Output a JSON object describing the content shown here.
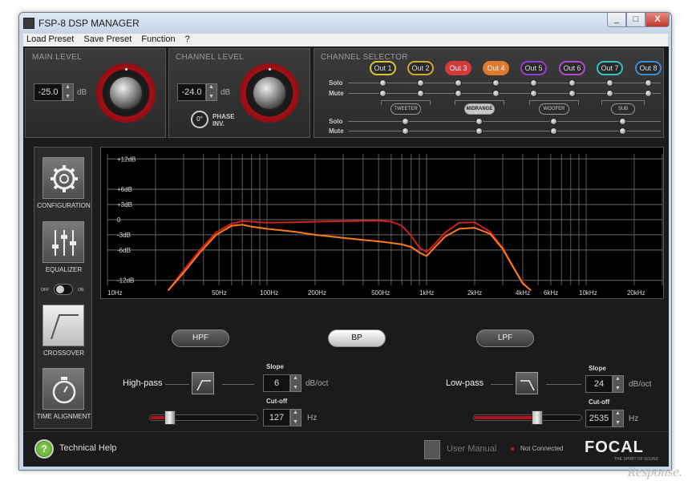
{
  "window": {
    "title": "FSP-8 DSP MANAGER",
    "minimize": "_",
    "maximize": "□",
    "close": "X"
  },
  "menu": [
    "Load Preset",
    "Save Preset",
    "Function",
    "?"
  ],
  "main_level": {
    "title": "MAIN LEVEL",
    "value": "-25.0",
    "unit": "dB"
  },
  "channel_level": {
    "title": "CHANNEL LEVEL",
    "value": "-24.0",
    "unit": "dB",
    "phase_value": "0°",
    "phase_label": "PHASE INV."
  },
  "channel_selector": {
    "title": "CHANNEL SELECTOR",
    "outputs": [
      {
        "label": "Out 1",
        "color": "#d8c531",
        "selected": false
      },
      {
        "label": "Out 2",
        "color": "#d8a531",
        "selected": false
      },
      {
        "label": "Out 3",
        "color": "#d23b3b",
        "selected": true
      },
      {
        "label": "Out 4",
        "color": "#e07a2e",
        "selected": true
      },
      {
        "label": "Out 5",
        "color": "#9b3ad1",
        "selected": false
      },
      {
        "label": "Out 6",
        "color": "#b14ad6",
        "selected": false
      },
      {
        "label": "Out 7",
        "color": "#31c3c3",
        "selected": false
      },
      {
        "label": "Out 8",
        "color": "#3a8fd8",
        "selected": false
      }
    ],
    "solo": "Solo",
    "mute": "Mute",
    "groups": [
      {
        "label": "TWEETER",
        "selected": false
      },
      {
        "label": "MIDRANGE",
        "selected": true
      },
      {
        "label": "WOOFER",
        "selected": false
      },
      {
        "label": "SUB",
        "selected": false
      }
    ]
  },
  "nav": [
    {
      "label": "CONFIGURATION",
      "icon": "gear-icon"
    },
    {
      "label": "EQUALIZER",
      "icon": "sliders-icon"
    },
    {
      "label": "CROSSOVER",
      "icon": "crossover-icon"
    },
    {
      "label": "TIME ALIGNMENT",
      "icon": "stopwatch-icon"
    }
  ],
  "eq_toggle": {
    "off": "OFF",
    "on": "ON"
  },
  "chart_data": {
    "type": "line",
    "x_scale": "log",
    "xlim": [
      10,
      30000
    ],
    "ylim": [
      -13,
      13
    ],
    "x_ticks": [
      {
        "value": 10,
        "label": "10Hz"
      },
      {
        "value": 50,
        "label": "50Hz"
      },
      {
        "value": 100,
        "label": "100Hz"
      },
      {
        "value": 200,
        "label": "200Hz"
      },
      {
        "value": 500,
        "label": "500Hz"
      },
      {
        "value": 1000,
        "label": "1kHz"
      },
      {
        "value": 2000,
        "label": "2kHz"
      },
      {
        "value": 4000,
        "label": "4kHz"
      },
      {
        "value": 6000,
        "label": "6kHz"
      },
      {
        "value": 10000,
        "label": "10kHz"
      },
      {
        "value": 20000,
        "label": "20kHz"
      }
    ],
    "y_ticks": [
      {
        "value": 12,
        "label": "+12dB"
      },
      {
        "value": 6,
        "label": "+6dB"
      },
      {
        "value": 3,
        "label": "+3dB"
      },
      {
        "value": 0,
        "label": "0"
      },
      {
        "value": -3,
        "label": "-3dB"
      },
      {
        "value": -6,
        "label": "-6dB"
      },
      {
        "value": -12,
        "label": "-12dB"
      }
    ],
    "grid": true,
    "series": [
      {
        "color": "#d0211c",
        "x": [
          24,
          30,
          38,
          48,
          60,
          70,
          80,
          100,
          150,
          200,
          300,
          500,
          600,
          700,
          800,
          900,
          1000,
          1100,
          1300,
          1600,
          2000,
          2500,
          3000,
          3500,
          4000,
          4500
        ],
        "y": [
          -14,
          -10,
          -6,
          -2.5,
          -0.8,
          -0.3,
          -0.4,
          -0.6,
          -0.5,
          -0.4,
          -0.3,
          -0.2,
          -0.4,
          -1.2,
          -3.2,
          -5.5,
          -6.4,
          -5.2,
          -2.6,
          -0.6,
          -0.5,
          -2.4,
          -5.6,
          -9.4,
          -12.5,
          -14
        ]
      },
      {
        "color": "#ff7a1a",
        "x": [
          24,
          30,
          38,
          48,
          60,
          70,
          80,
          100,
          150,
          200,
          300,
          400,
          500,
          600,
          700,
          800,
          900,
          1000,
          1100,
          1300,
          1600,
          2000,
          2500,
          3000,
          3500,
          4000,
          4500
        ],
        "y": [
          -14,
          -10.5,
          -6.5,
          -3,
          -1.2,
          -1,
          -1.4,
          -1.8,
          -2.4,
          -3,
          -3.6,
          -4,
          -4.3,
          -4.6,
          -4.9,
          -5.4,
          -6.5,
          -7.2,
          -5.8,
          -3.4,
          -1.8,
          -1.6,
          -2.8,
          -5.8,
          -9.5,
          -12.6,
          -14
        ]
      }
    ]
  },
  "filter_tabs": [
    {
      "label": "HPF",
      "active": false
    },
    {
      "label": "BP",
      "active": true
    },
    {
      "label": "LPF",
      "active": false
    }
  ],
  "high_pass": {
    "label": "High-pass",
    "slope_label": "Slope",
    "slope_value": "6",
    "slope_unit": "dB/oct",
    "cutoff_label": "Cut-off",
    "cutoff_value": "127",
    "cutoff_unit": "Hz",
    "slider_position": 0.15
  },
  "low_pass": {
    "label": "Low-pass",
    "slope_label": "Slope",
    "slope_value": "24",
    "slope_unit": "dB/oct",
    "cutoff_label": "Cut-off",
    "cutoff_value": "2535",
    "cutoff_unit": "Hz",
    "slider_position": 0.6
  },
  "footer": {
    "help_icon": "?",
    "help_label": "Technical Help",
    "manual_label": "User Manual",
    "status": "Not Connected",
    "brand": "FOCAL",
    "tagline": "THE SPIRIT OF SOUND"
  },
  "watermark": "Response."
}
